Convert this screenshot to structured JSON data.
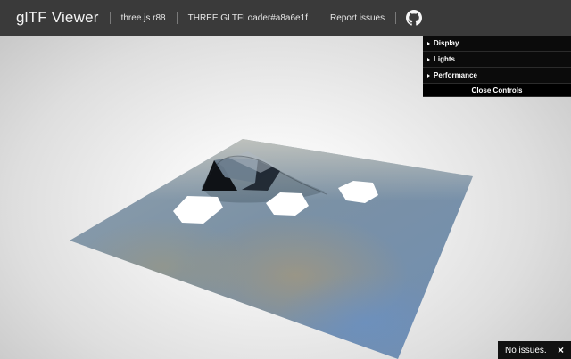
{
  "header": {
    "title": "glTF Viewer",
    "links": [
      {
        "label": "three.js r88"
      },
      {
        "label": "THREE.GLTFLoader#a8a6e1f"
      },
      {
        "label": "Report issues"
      }
    ],
    "github_icon": "github-icon"
  },
  "controls": {
    "folders": [
      {
        "label": "Display"
      },
      {
        "label": "Lights"
      },
      {
        "label": "Performance"
      }
    ],
    "close_label": "Close Controls",
    "folder_icon": "triangle-right-icon"
  },
  "status": {
    "message": "No issues.",
    "close_glyph": "×",
    "close_icon": "close-icon"
  },
  "colors": {
    "header_bg": "#3a3a3a",
    "panel_bg": "#0b0b0b",
    "scene_plane": "#7e96aa",
    "scene_mound": "#25313d",
    "status_bg": "#111111"
  }
}
